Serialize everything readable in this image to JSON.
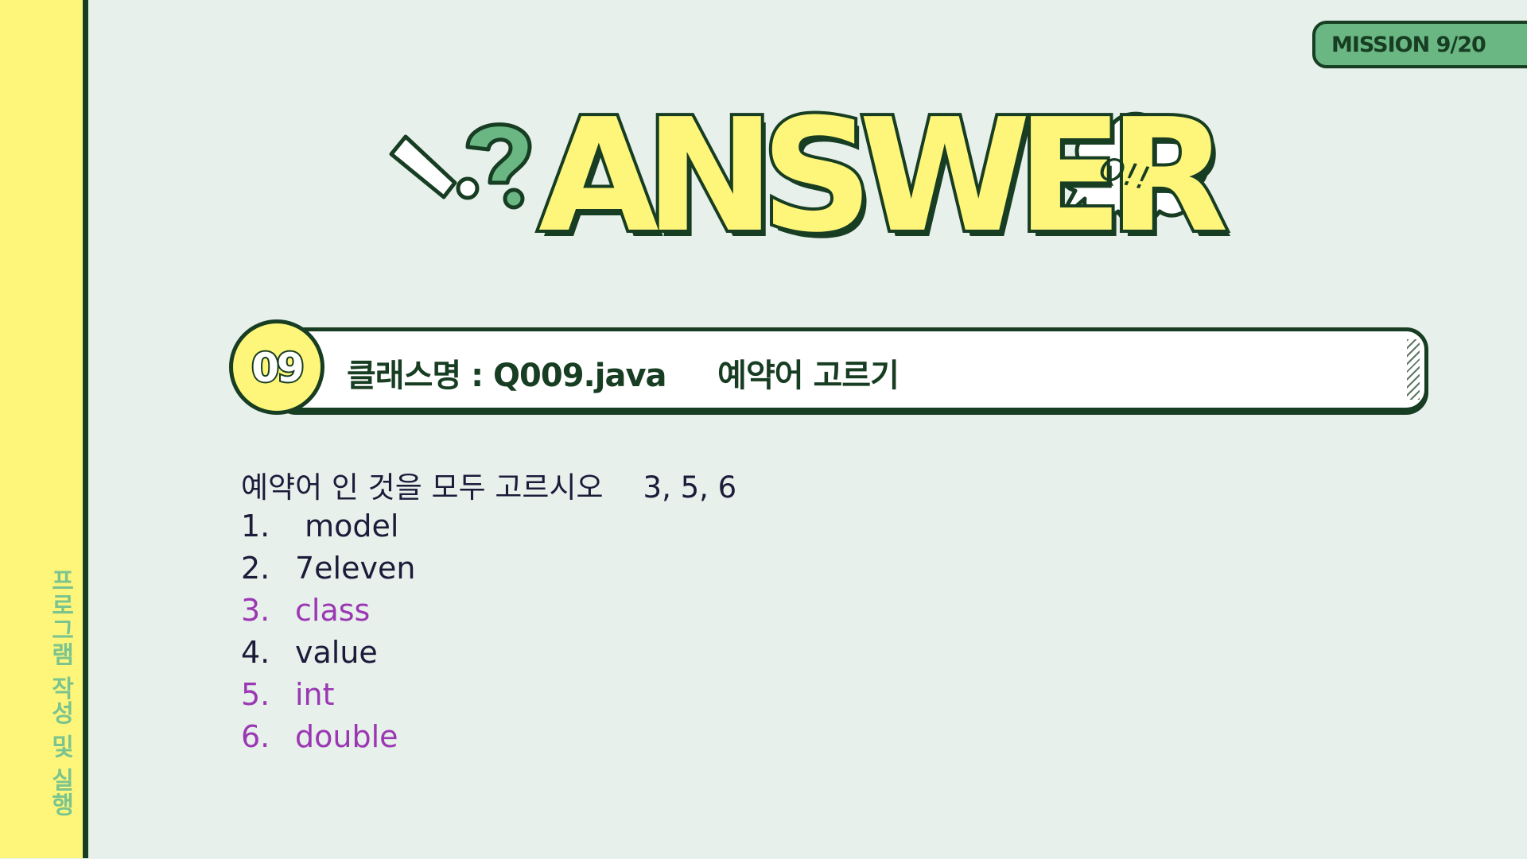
{
  "sidebar": {
    "label": "프로그램 작성 및 실행"
  },
  "mission": {
    "label": "MISSION 9/20"
  },
  "hero": {
    "title": "ANSWER",
    "bubble": "Q!!"
  },
  "question": {
    "number": "09",
    "title": "클래스명 : Q009.java     예약어 고르기"
  },
  "prompt": {
    "text": "예약어 인 것을 모두 고르시오",
    "answer": "3, 5, 6"
  },
  "options": [
    {
      "num": "1.",
      "word": " model"
    },
    {
      "num": "2.",
      "word": "7eleven"
    },
    {
      "num": "3.",
      "word": "class"
    },
    {
      "num": "4.",
      "word": "value"
    },
    {
      "num": "5.",
      "word": "int"
    },
    {
      "num": "6.",
      "word": "double"
    }
  ],
  "colors": {
    "background": "#e7f0eb",
    "sidebar": "#fef67a",
    "dark_green": "#173d22",
    "green": "#6ab783",
    "highlight": "#9b37b3",
    "text": "#1b1b3a"
  },
  "icons": [
    "exclamation-icon",
    "question-mark-icon",
    "speech-bubble-icon"
  ]
}
